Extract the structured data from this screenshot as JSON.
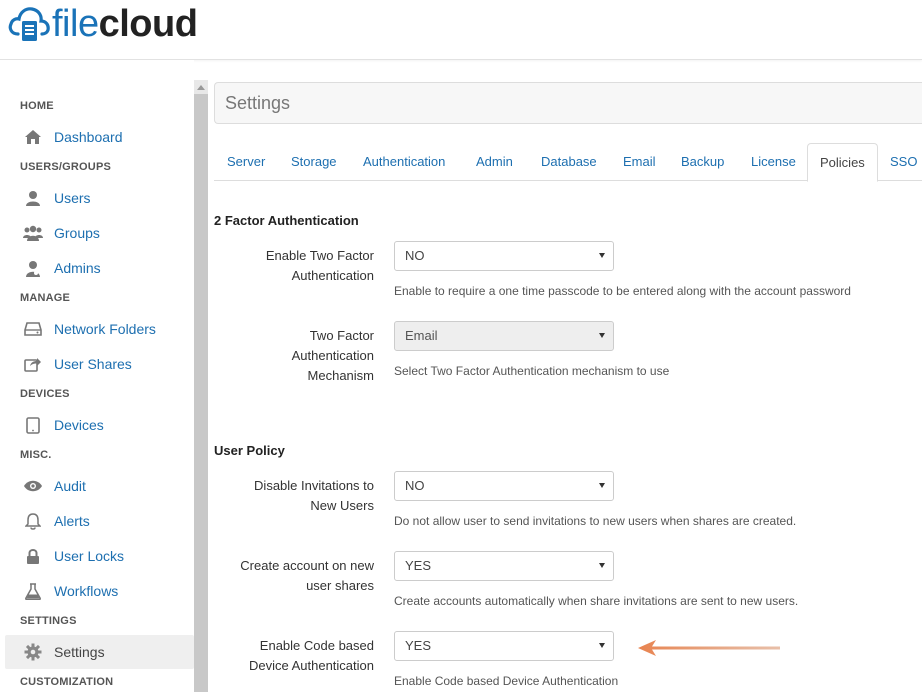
{
  "header": {
    "logo_part1": "file",
    "logo_part2": "cloud"
  },
  "sidebar": {
    "sections": [
      {
        "label": "HOME"
      },
      {
        "label": "USERS/GROUPS"
      },
      {
        "label": "MANAGE"
      },
      {
        "label": "DEVICES"
      },
      {
        "label": "MISC."
      },
      {
        "label": "SETTINGS"
      },
      {
        "label": "CUSTOMIZATION"
      }
    ],
    "items": [
      {
        "label": "Dashboard",
        "icon": "home-icon"
      },
      {
        "label": "Users",
        "icon": "user-icon"
      },
      {
        "label": "Groups",
        "icon": "group-icon"
      },
      {
        "label": "Admins",
        "icon": "admin-icon"
      },
      {
        "label": "Network Folders",
        "icon": "drive-icon"
      },
      {
        "label": "User Shares",
        "icon": "share-icon"
      },
      {
        "label": "Devices",
        "icon": "tablet-icon"
      },
      {
        "label": "Audit",
        "icon": "eye-icon"
      },
      {
        "label": "Alerts",
        "icon": "bell-icon"
      },
      {
        "label": "User Locks",
        "icon": "lock-icon"
      },
      {
        "label": "Workflows",
        "icon": "flask-icon"
      },
      {
        "label": "Settings",
        "icon": "gear-icon"
      }
    ]
  },
  "page": {
    "title": "Settings"
  },
  "tabs": [
    {
      "label": "Server"
    },
    {
      "label": "Storage"
    },
    {
      "label": "Authentication"
    },
    {
      "label": "Admin"
    },
    {
      "label": "Database"
    },
    {
      "label": "Email"
    },
    {
      "label": "Backup"
    },
    {
      "label": "License"
    },
    {
      "label": "Policies"
    },
    {
      "label": "SSO"
    }
  ],
  "form": {
    "sections": [
      {
        "title": "2 Factor Authentication"
      },
      {
        "title": "User Policy"
      }
    ],
    "fields": [
      {
        "label_line1": "Enable Two Factor",
        "label_line2": "Authentication",
        "label_line3": "",
        "value": "NO",
        "help": "Enable to require a one time passcode to be entered along with the account password"
      },
      {
        "label_line1": "Two Factor",
        "label_line2": "Authentication",
        "label_line3": "Mechanism",
        "value": "Email",
        "help": "Select Two Factor Authentication mechanism to use"
      },
      {
        "label_line1": "Disable Invitations to",
        "label_line2": "New Users",
        "label_line3": "",
        "value": "NO",
        "help": "Do not allow user to send invitations to new users when shares are created."
      },
      {
        "label_line1": "Create account on new",
        "label_line2": "user shares",
        "label_line3": "",
        "value": "YES",
        "help": "Create accounts automatically when share invitations are sent to new users."
      },
      {
        "label_line1": "Enable Code based",
        "label_line2": "Device Authentication",
        "label_line3": "",
        "value": "YES",
        "help": "Enable Code based Device Authentication"
      }
    ]
  },
  "colors": {
    "link": "#1d6fb0",
    "arrow": "#e8834f"
  }
}
